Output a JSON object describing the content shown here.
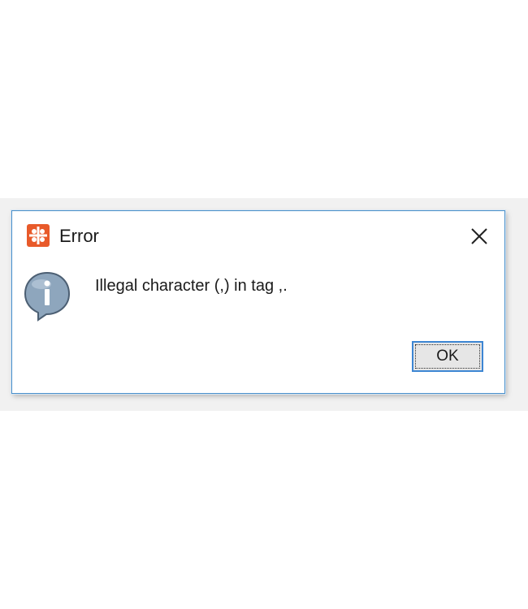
{
  "dialog": {
    "title": "Error",
    "app_icon": "app-logo-icon",
    "close_icon": "close-icon",
    "message_icon": "info-icon",
    "message": "Illegal character (,) in tag ,.",
    "ok_label": "OK"
  },
  "colors": {
    "accent_border": "#4a8fc9",
    "app_icon_bg": "#e85a2a",
    "button_focus_border": "#3d86d3",
    "button_bg": "#e6e6e6",
    "info_icon_fill": "#8ea6bd"
  }
}
